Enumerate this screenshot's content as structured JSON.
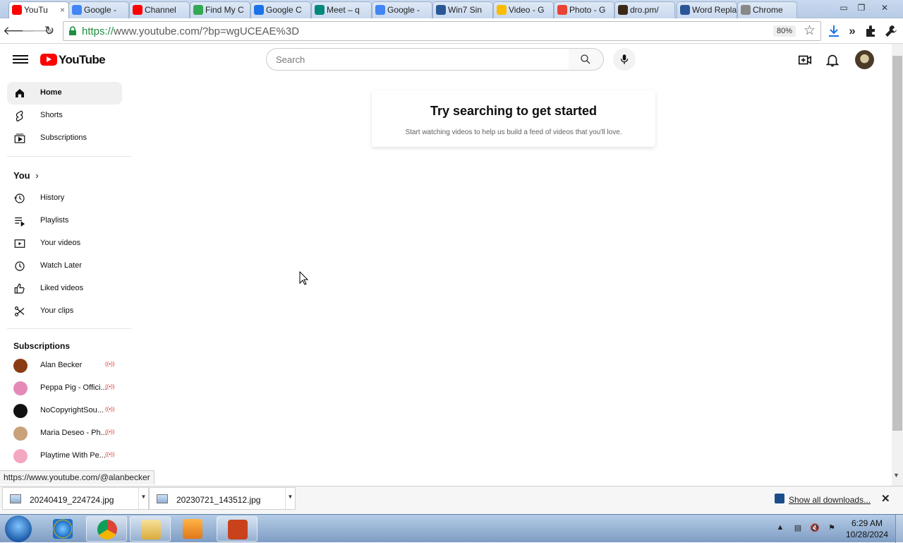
{
  "browser": {
    "tabs": [
      {
        "title": "YouTu",
        "favicon_color": "#ff0000",
        "active": true,
        "close": "×"
      },
      {
        "title": "Google -",
        "favicon_color": "#4285f4"
      },
      {
        "title": "Channel",
        "favicon_color": "#ff0000"
      },
      {
        "title": "Find My C",
        "favicon_color": "#34a853"
      },
      {
        "title": "Google C",
        "favicon_color": "#1a73e8"
      },
      {
        "title": "Meet – q",
        "favicon_color": "#00897b"
      },
      {
        "title": "Google -",
        "favicon_color": "#4285f4"
      },
      {
        "title": "Win7 Sin",
        "favicon_color": "#2b5797"
      },
      {
        "title": "Video - G",
        "favicon_color": "#fbbc04"
      },
      {
        "title": "Photo - G",
        "favicon_color": "#ea4335"
      },
      {
        "title": "dro.pm/",
        "favicon_color": "#3b2a1a"
      },
      {
        "title": "Word Repla",
        "favicon_color": "#2b579a"
      },
      {
        "title": "Chrome",
        "favicon_color": "#888888"
      }
    ],
    "url_scheme": "https://",
    "url_rest": "www.youtube.com/?bp=wgUCEAE%3D",
    "zoom": "80%"
  },
  "youtube": {
    "logo_text": "YouTube",
    "search_placeholder": "Search",
    "nav_main": [
      {
        "label": "Home",
        "icon": "home-icon",
        "active": true
      },
      {
        "label": "Shorts",
        "icon": "shorts-icon"
      },
      {
        "label": "Subscriptions",
        "icon": "subscriptions-icon"
      }
    ],
    "you_heading": "You",
    "you_chevron": "›",
    "nav_you": [
      {
        "label": "History",
        "icon": "history-icon"
      },
      {
        "label": "Playlists",
        "icon": "playlists-icon"
      },
      {
        "label": "Your videos",
        "icon": "your-videos-icon"
      },
      {
        "label": "Watch Later",
        "icon": "watch-later-icon"
      },
      {
        "label": "Liked videos",
        "icon": "liked-icon"
      },
      {
        "label": "Your clips",
        "icon": "clips-icon"
      }
    ],
    "subscriptions_heading": "Subscriptions",
    "subscriptions": [
      {
        "name": "Alan Becker",
        "color": "#8a3b12"
      },
      {
        "name": "Peppa Pig - Offici...",
        "color": "#e58ab8"
      },
      {
        "name": "NoCopyrightSou...",
        "color": "#111111"
      },
      {
        "name": "Maria Deseo - Ph...",
        "color": "#c9a27a"
      },
      {
        "name": "Playtime With Pe...",
        "color": "#f4a7c3"
      }
    ],
    "live_glyph": "((•))",
    "empty_title": "Try searching to get started",
    "empty_subtitle": "Start watching videos to help us build a feed of videos that you'll love."
  },
  "status_url": "https://www.youtube.com/@alanbecker",
  "downloads": {
    "items": [
      "20240419_224724.jpg",
      "20230721_143512.jpg"
    ],
    "show_all": "Show all downloads...",
    "close": "✕"
  },
  "taskbar": {
    "time": "6:29 AM",
    "date": "10/28/2024"
  }
}
